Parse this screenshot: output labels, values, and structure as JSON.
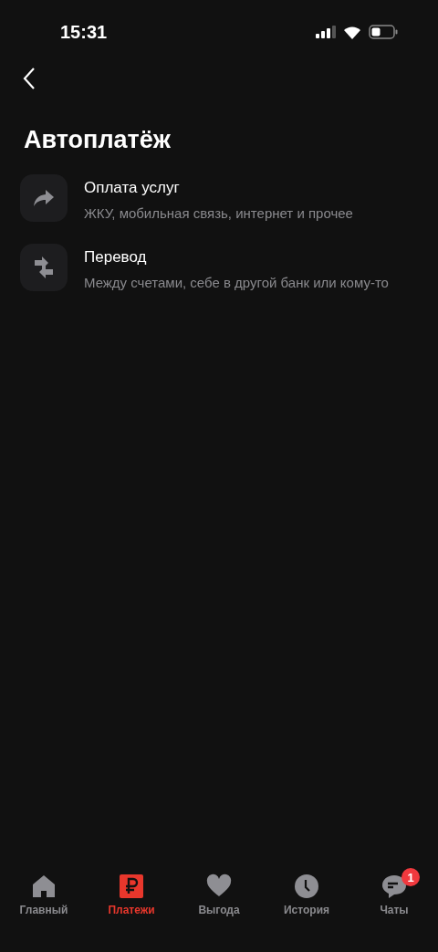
{
  "status_bar": {
    "time": "15:31"
  },
  "title": "Автоплатёж",
  "items": [
    {
      "kind": "share",
      "title": "Оплата услуг",
      "subtitle": "ЖКУ, мобильная связь, интернет и прочее"
    },
    {
      "kind": "transfer",
      "title": "Перевод",
      "subtitle": "Между счетами, себе в другой банк или кому-то"
    }
  ],
  "tab_bar": [
    {
      "kind": "home",
      "label": "Главный",
      "selected": false
    },
    {
      "kind": "ruble",
      "label": "Платежи",
      "selected": true
    },
    {
      "kind": "heart",
      "label": "Выгода",
      "selected": false
    },
    {
      "kind": "clock",
      "label": "История",
      "selected": false
    },
    {
      "kind": "chat",
      "label": "Чаты",
      "selected": false,
      "badge": "1"
    }
  ]
}
